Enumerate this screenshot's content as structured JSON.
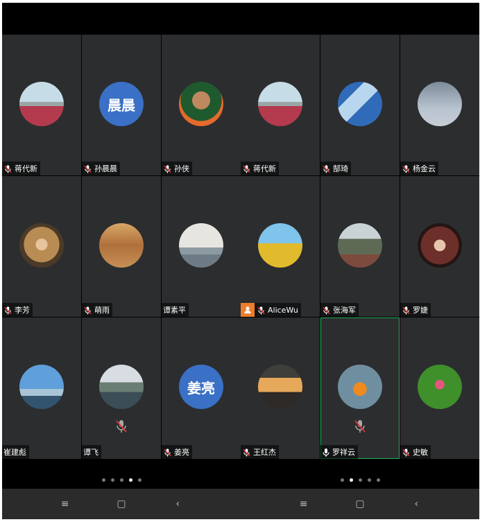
{
  "left_screen": {
    "tiles": [
      {
        "name": "蒋代新",
        "avatar": "p-flowers",
        "mic": "off"
      },
      {
        "name": "孙晨晨",
        "avatar_text": "晨晨",
        "mic": "off"
      },
      {
        "name": "孙侠",
        "avatar": "p-person",
        "mic": "off"
      },
      {
        "name": "李芳",
        "avatar": "p-hair",
        "mic": "off"
      },
      {
        "name": "萌雨",
        "avatar": "p-autumn",
        "mic": "off"
      },
      {
        "name": "谭素平",
        "avatar": "p-mist",
        "mic": "none"
      },
      {
        "name": "崔建彪",
        "avatar": "p-jump",
        "mic": "none"
      },
      {
        "name": "谭飞",
        "avatar": "p-lake",
        "mic": "none",
        "center_mic": "muted"
      },
      {
        "name": "姜亮",
        "avatar_text": "姜亮",
        "mic": "off"
      }
    ],
    "page_dots": {
      "count": 5,
      "active_index": 3
    }
  },
  "right_screen": {
    "tiles": [
      {
        "name": "蒋代新",
        "avatar": "p-flowers",
        "mic": "off"
      },
      {
        "name": "郜琦",
        "avatar": "p-surf",
        "mic": "off"
      },
      {
        "name": "杨金云",
        "avatar": "p-sky",
        "mic": "off"
      },
      {
        "name": "AliceWu",
        "avatar": "p-wheat",
        "mic": "off",
        "self_badge": "user-icon"
      },
      {
        "name": "张海军",
        "avatar": "p-falls",
        "mic": "off"
      },
      {
        "name": "罗婕",
        "avatar": "p-girl",
        "mic": "off"
      },
      {
        "name": "王红杰",
        "avatar": "p-sunset",
        "mic": "off"
      },
      {
        "name": "罗祥云",
        "avatar": "p-orange",
        "mic": "on",
        "active": true,
        "center_mic": "muted"
      },
      {
        "name": "史敏",
        "avatar": "p-lotus",
        "mic": "off"
      }
    ],
    "page_dots": {
      "count": 5,
      "active_index": 1
    }
  },
  "navbar": {
    "menu": "≡",
    "home": "▢",
    "back": "‹"
  },
  "colors": {
    "tile_bg": "#2c2d2f",
    "active_border": "#1fb35a",
    "avatar_text_bg": "#3a70c6",
    "badge": "#ef7d2b"
  }
}
